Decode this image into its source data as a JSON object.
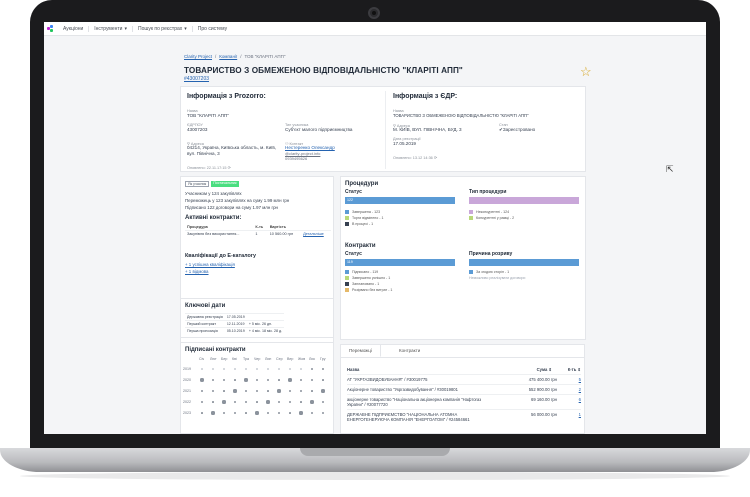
{
  "nav": {
    "items": [
      "Аукціони",
      "Інструменти",
      "Пошук по реєстрах",
      "Про систему"
    ],
    "dropdown_flags": [
      false,
      true,
      true,
      false
    ]
  },
  "breadcrumb": {
    "root": "Clarity Project",
    "section": "Компанії",
    "current": "ТОВ \"КЛАРІТІ АПП\""
  },
  "company": {
    "title": "ТОВАРИСТВО З ОБМЕЖЕНОЮ ВІДПОВІДАЛЬНІСТЮ \"КЛАРІТІ АПП\"",
    "code": "#43007203"
  },
  "prozorro": {
    "heading": "Інформація з Prozorro:",
    "name_label": "Назва",
    "name_value": "ТОВ \"КЛАРІТІ АПП\"",
    "edrpou_label": "ЄДРПОУ",
    "edrpou_value": "43007203",
    "type_label": "Тип учасника",
    "type_value": "Суб'єкт малого підприємництва",
    "address_label": "Адреса",
    "address_value": "04214, Україна, Київська область, м. Київ, вул. Північна, 3",
    "contact_label": "Контакт",
    "contact_name": "Нестеренко Олександр",
    "contact_email": "@clarity-project.info",
    "contact_phone": "0939495626",
    "updated": "Оновлено: 22.11.17:15"
  },
  "edr": {
    "heading": "Інформація з ЄДР:",
    "name_label": "Назва",
    "name_value": "ТОВАРИСТВО З ОБМЕЖЕНОЮ ВІДПОВІДАЛЬНІСТЮ \"КЛАРІТІ АПП\"",
    "address_label": "Адреса",
    "address_value": "М. КИЇВ, ВУЛ. ПІВНІЧНА, БУД. 3",
    "status_label": "Стан",
    "status_value": "Зареєстровано",
    "reg_label": "Дата реєстрації",
    "reg_value": "17.05.2019",
    "updated": "Оновлено: 13.12 14:36"
  },
  "roles": {
    "tag_participant": "Як учасник",
    "tag_customer": "Постачальник",
    "participated": "Учасником у 124 закупівлях",
    "won": "Переможець у 123 закупівлях на суму 1.99 млн грн",
    "signed": "Підписано 122 договори на суму 1.97 млн грн"
  },
  "active": {
    "heading": "Активні контракти:",
    "columns": [
      "Процедура",
      "К-ть",
      "Вартість"
    ],
    "rows": [
      [
        "Закупівля без використання...",
        "1",
        "10 560.00 грн"
      ]
    ],
    "details_link": "Детальніше"
  },
  "qualification": {
    "heading": "Кваліфікації до E-каталогу",
    "item1": "+ 1 успішна кваліфікація",
    "item2": "+ 1 відмова"
  },
  "dates": {
    "heading": "Ключові дати",
    "rows": [
      [
        "Державна реєстрація",
        "17.05.2019",
        ""
      ],
      [
        "Перший контракт",
        "12.11.2019",
        "+ 5 міс. 26 дн."
      ],
      [
        "Перша пропозиція",
        "05.10.2019",
        "+ 4 міс. 18 міс. 28 д."
      ]
    ]
  },
  "signed": {
    "heading": "Підписані контракти",
    "months": [
      "Січ",
      "Лют",
      "Бер",
      "Кві",
      "Тра",
      "Чер",
      "Лип",
      "Сер",
      "Вер",
      "Жов",
      "Лис",
      "Гру"
    ],
    "years": [
      "2019",
      "2020",
      "2021",
      "2022",
      "2023"
    ]
  },
  "procedures": {
    "heading": "Процедури",
    "status_heading": "Статус",
    "status_bar_value": "122",
    "status_legend": [
      "Завершена - 123",
      "Торги відмінено - 1",
      "В процесі - 1"
    ],
    "type_heading": "Тип процедури",
    "type_legend": [
      "Неконкурентні - 124",
      "Конкурентні у рамці - 2"
    ]
  },
  "contracts": {
    "heading": "Контракти",
    "status_heading": "Статус",
    "status_bar_value": "119",
    "status_legend": [
      "Підписано - 119",
      "Завершено успішно - 1",
      "Заплановано - 1",
      "Розірвано без витрат - 1"
    ],
    "reason_heading": "Причина розриву",
    "reason_legend": [
      "За згодою сторін - 1",
      "Неможливо реалізувати договори"
    ]
  },
  "chart_colors": {
    "blue": "#5b9bd5",
    "purple": "#c9a7d9",
    "green": "#b9d87a",
    "gray": "#e5e7eb"
  },
  "bottom_tabs": {
    "tab1": "Переможці",
    "tab2": "Контракти",
    "col_name": "Назва",
    "col_sum": "Сума",
    "col_count": "К-ть",
    "rows": [
      {
        "name": "АТ \"УКРГАЗВИДОБУВАННЯ\" / #30019775",
        "sum": "475 400.00 грн",
        "count": "5"
      },
      {
        "name": "Акціонерне товариство \"Укргазвидобування\" / #30019801",
        "sum": "552 900.00 грн",
        "count": "2"
      },
      {
        "name": "акціонерне товариство \"Національна акціонерна компанія \"Нафтогаз України\" / #20077720",
        "sum": "69 160.00 грн",
        "count": "6"
      },
      {
        "name": "ДЕРЖАВНЕ ПІДПРИЄМСТВО \"НАЦІОНАЛЬНА АТОМНА ЕНЕРГОГЕНЕРУЮЧА КОМПАНІЯ \"ЕНЕРГОАТОМ\" / #24584661",
        "sum": "56 000.00 грн",
        "count": "1"
      }
    ]
  }
}
